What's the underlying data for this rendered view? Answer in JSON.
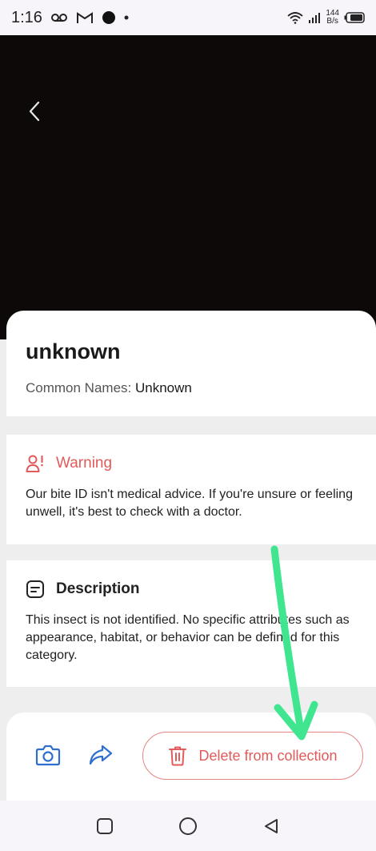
{
  "status_bar": {
    "time": "1:16",
    "net_speed_value": "144",
    "net_speed_unit": "B/s"
  },
  "title": "unknown",
  "common_names": {
    "label": "Common Names:",
    "value": "Unknown"
  },
  "warning": {
    "heading": "Warning",
    "text": "Our bite ID isn't medical advice. If you're unsure or feeling unwell, it's best to check with a doctor."
  },
  "description": {
    "heading": "Description",
    "text": "This insect is not identified. No specific attributes such as appearance, habitat, or behavior can be defined for this category."
  },
  "actions": {
    "delete_label": "Delete from collection"
  },
  "icons": {
    "back": "chevron-left-icon",
    "warning": "person-alert-icon",
    "description": "note-icon",
    "camera": "camera-icon",
    "share": "share-icon",
    "delete": "trash-icon"
  },
  "colors": {
    "accent_red": "#e35a5a",
    "annotation_arrow": "#3fe68f",
    "blue_icon": "#2f6fcf"
  }
}
